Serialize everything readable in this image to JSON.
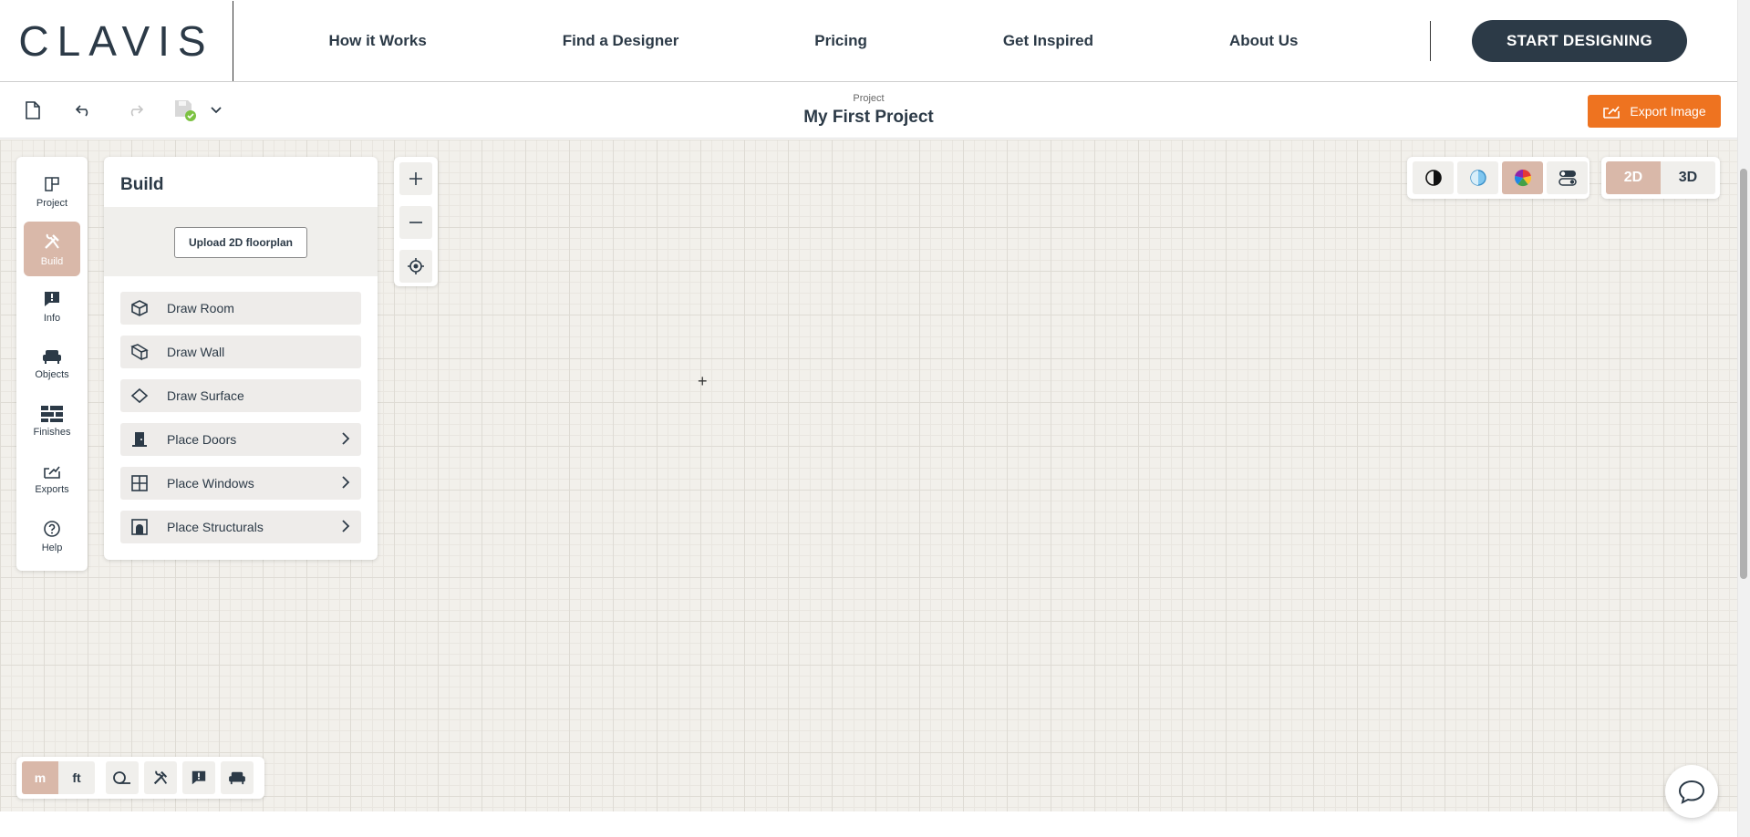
{
  "nav": {
    "logo": "CLAVIS",
    "links": [
      "How it Works",
      "Find a Designer",
      "Pricing",
      "Get Inspired",
      "About Us"
    ],
    "cta": "START DESIGNING"
  },
  "toolbar": {
    "project_label": "Project",
    "project_name": "My First Project",
    "export_label": "Export Image"
  },
  "rail": {
    "items": [
      "Project",
      "Build",
      "Info",
      "Objects",
      "Finishes",
      "Exports",
      "Help"
    ],
    "active": "Build"
  },
  "build": {
    "title": "Build",
    "upload_label": "Upload 2D floorplan",
    "tools": [
      "Draw Room",
      "Draw Wall",
      "Draw Surface",
      "Place Doors",
      "Place Windows",
      "Place Structurals"
    ]
  },
  "view": {
    "dim_2d": "2D",
    "dim_3d": "3D"
  },
  "units": {
    "metric": "m",
    "imperial": "ft"
  },
  "colors": {
    "accent": "#ee7320",
    "active": "#d9b8a9",
    "dark": "#2c3a47",
    "canvas": "#f2f0eb"
  }
}
